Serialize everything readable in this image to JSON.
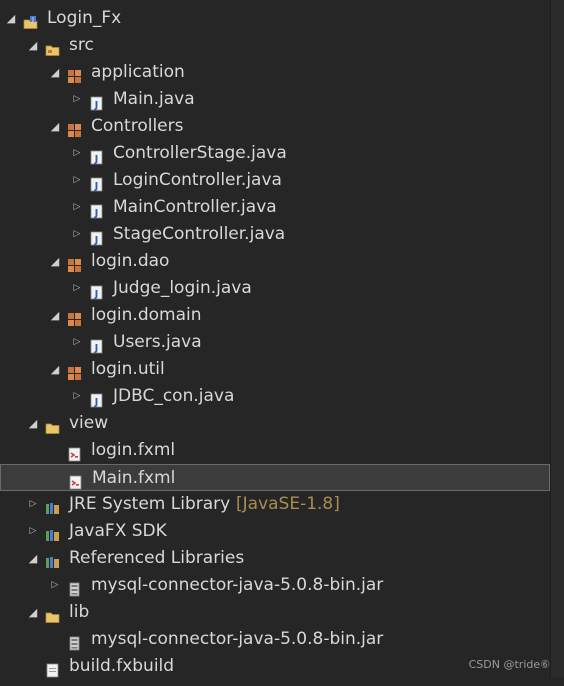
{
  "tree": {
    "rows": [
      {
        "label": "Login_Fx",
        "decoration": "",
        "expanded": true,
        "icon": "java-project-icon",
        "depth": 0
      },
      {
        "label": "src",
        "decoration": "",
        "expanded": true,
        "icon": "source-folder-icon",
        "depth": 1
      },
      {
        "label": "application",
        "decoration": "",
        "expanded": true,
        "icon": "package-icon",
        "depth": 2
      },
      {
        "label": "Main.java",
        "decoration": "",
        "expanded": false,
        "icon": "java-file-icon",
        "depth": 3
      },
      {
        "label": "Controllers",
        "decoration": "",
        "expanded": true,
        "icon": "package-icon",
        "depth": 2
      },
      {
        "label": "ControllerStage.java",
        "decoration": "",
        "expanded": false,
        "icon": "java-file-icon",
        "depth": 3
      },
      {
        "label": "LoginController.java",
        "decoration": "",
        "expanded": false,
        "icon": "java-file-icon",
        "depth": 3
      },
      {
        "label": "MainController.java",
        "decoration": "",
        "expanded": false,
        "icon": "java-file-icon",
        "depth": 3
      },
      {
        "label": "StageController.java",
        "decoration": "",
        "expanded": false,
        "icon": "java-file-icon",
        "depth": 3
      },
      {
        "label": "login.dao",
        "decoration": "",
        "expanded": true,
        "icon": "package-icon",
        "depth": 2
      },
      {
        "label": "Judge_login.java",
        "decoration": "",
        "expanded": false,
        "icon": "java-file-icon",
        "depth": 3
      },
      {
        "label": "login.domain",
        "decoration": "",
        "expanded": true,
        "icon": "package-icon",
        "depth": 2
      },
      {
        "label": "Users.java",
        "decoration": "",
        "expanded": false,
        "icon": "java-file-icon",
        "depth": 3
      },
      {
        "label": "login.util",
        "decoration": "",
        "expanded": true,
        "icon": "package-icon",
        "depth": 2
      },
      {
        "label": "JDBC_con.java",
        "decoration": "",
        "expanded": false,
        "icon": "java-file-icon",
        "depth": 3
      },
      {
        "label": "view",
        "decoration": "",
        "expanded": true,
        "icon": "folder-icon",
        "depth": 1
      },
      {
        "label": "login.fxml",
        "decoration": "",
        "expanded": null,
        "icon": "fxml-file-icon",
        "depth": 2
      },
      {
        "label": "Main.fxml",
        "decoration": "",
        "expanded": null,
        "icon": "fxml-file-icon",
        "depth": 2,
        "selected": true
      },
      {
        "label": "JRE System Library",
        "decoration": "[JavaSE-1.8]",
        "expanded": false,
        "icon": "library-icon",
        "depth": 1
      },
      {
        "label": "JavaFX SDK",
        "decoration": "",
        "expanded": false,
        "icon": "library-icon",
        "depth": 1
      },
      {
        "label": "Referenced Libraries",
        "decoration": "",
        "expanded": true,
        "icon": "library-icon",
        "depth": 1
      },
      {
        "label": "mysql-connector-java-5.0.8-bin.jar",
        "decoration": "",
        "expanded": false,
        "icon": "jar-icon",
        "depth": 2
      },
      {
        "label": "lib",
        "decoration": "",
        "expanded": true,
        "icon": "folder-icon",
        "depth": 1
      },
      {
        "label": "mysql-connector-java-5.0.8-bin.jar",
        "decoration": "",
        "expanded": null,
        "icon": "jar-file-icon",
        "depth": 2
      },
      {
        "label": "build.fxbuild",
        "decoration": "",
        "expanded": null,
        "icon": "file-icon",
        "depth": 1
      }
    ]
  },
  "watermark": "CSDN @tride⑥",
  "colors": {
    "background": "#262626",
    "text": "#d8d8d8",
    "decoration": "#a98d4f",
    "selection": "#3c3c3c",
    "package": "#c8743a",
    "java_file": "#4a7bd0",
    "folder": "#e8c46a"
  }
}
